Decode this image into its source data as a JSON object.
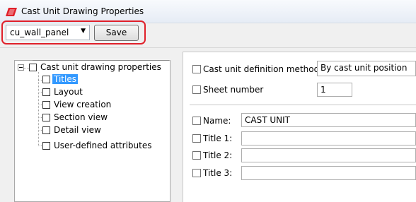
{
  "window": {
    "title": "Cast Unit Drawing Properties",
    "icon": "tekla-drawing-icon",
    "accent_color": "#e0202a"
  },
  "toolbar": {
    "preset_value": "cu_wall_panel",
    "save_label": "Save"
  },
  "tree": {
    "root_label": "Cast unit drawing properties",
    "items": [
      {
        "label": "Titles",
        "selected": true
      },
      {
        "label": "Layout",
        "selected": false
      },
      {
        "label": "View creation",
        "selected": false
      },
      {
        "label": "Section view",
        "selected": false
      },
      {
        "label": "Detail view",
        "selected": false
      },
      {
        "label": "User-defined attributes",
        "selected": false
      }
    ]
  },
  "properties": {
    "definition_method_label": "Cast unit definition method",
    "definition_method_value": "By cast unit position",
    "sheet_number_label": "Sheet number",
    "sheet_number_value": "1",
    "name_label": "Name:",
    "name_value": "CAST UNIT",
    "title1_label": "Title 1:",
    "title1_value": "",
    "title2_label": "Title 2:",
    "title2_value": "",
    "title3_label": "Title 3:",
    "title3_value": ""
  }
}
